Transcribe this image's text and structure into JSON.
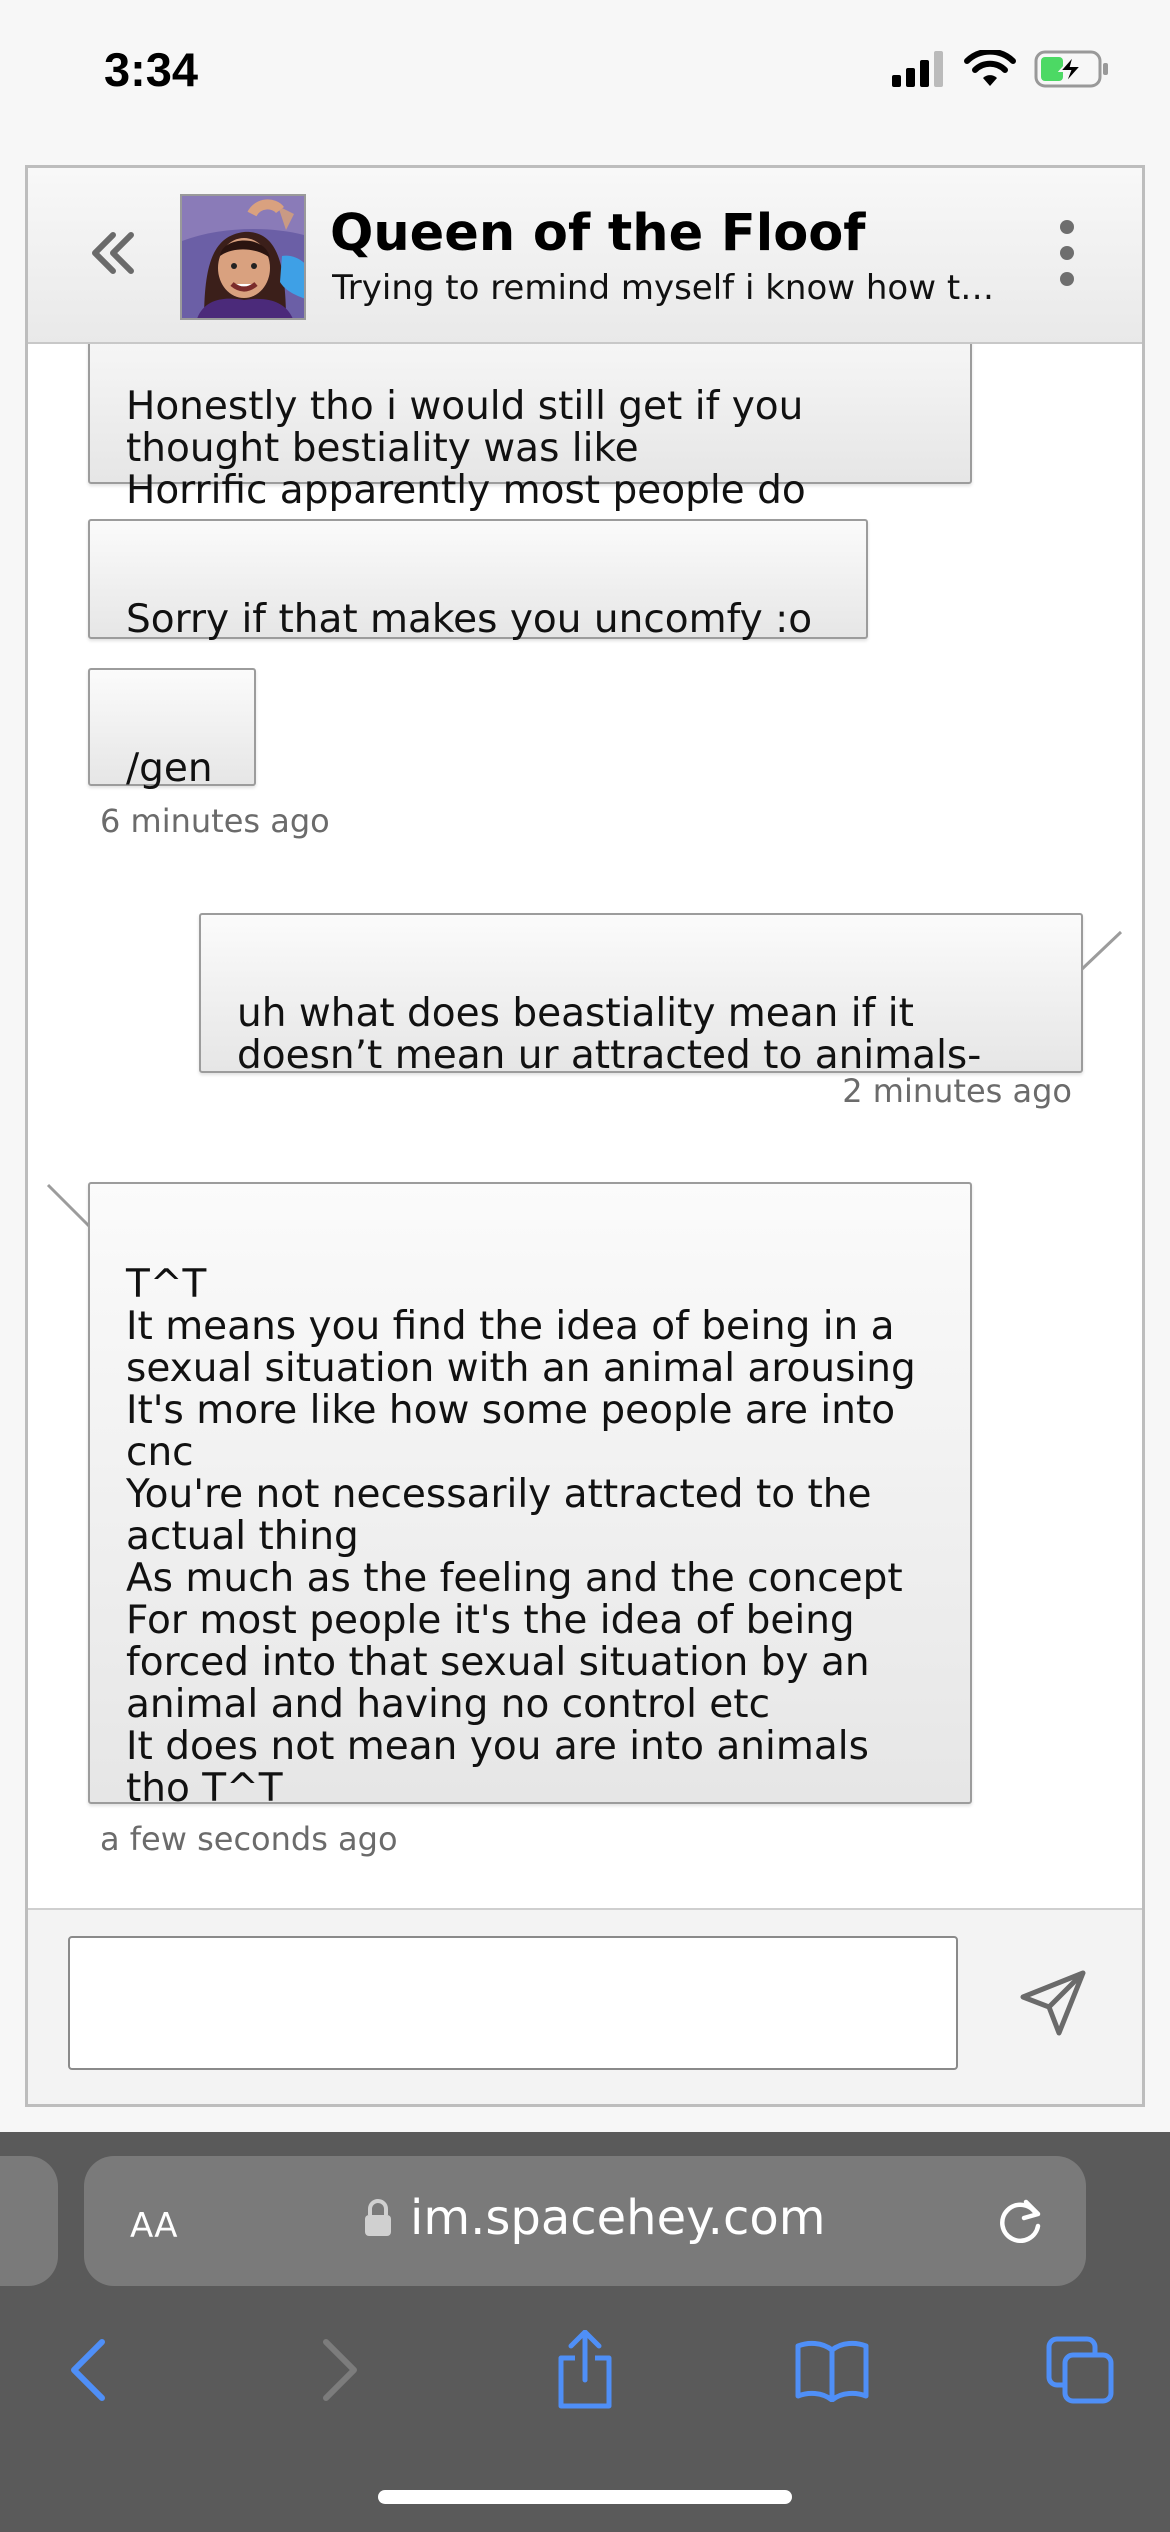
{
  "status_bar": {
    "time": "3:34"
  },
  "chat": {
    "contact_name": "Queen of the Floof",
    "contact_status": "Trying to remind myself i know how to...",
    "messages": [
      {
        "direction": "received",
        "text": "Honestly tho i would still get if you\nthought bestiality was like\nHorrific apparently most people do"
      },
      {
        "direction": "received",
        "text": "Sorry if that makes you uncomfy :o"
      },
      {
        "direction": "received",
        "text": "/gen"
      },
      {
        "direction": "sent",
        "text": "uh what does beastiality mean if it\ndoesn’t mean ur attracted to animals-"
      },
      {
        "direction": "received",
        "text": "T^T\nIt means you find the idea of being in a\nsexual situation with an animal arousing\nIt's more like how some people are into\ncnc\nYou're not necessarily attracted to the\nactual thing\nAs much as the feeling and the concept\nFor most people it's the idea of being\nforced into that sexual situation by an\nanimal and having no control etc\nIt does not mean you are into animals\ntho T^T"
      }
    ],
    "timestamps": [
      "6 minutes ago",
      "2 minutes ago",
      "a few seconds ago"
    ],
    "composer": {
      "value": ""
    }
  },
  "browser": {
    "text_size_button_label": "AA",
    "url": "im.spacehey.com"
  },
  "icons": {
    "back": "double-chevron-left-icon",
    "menu": "vertical-ellipsis-icon",
    "send": "paper-plane-icon",
    "lock": "lock-icon",
    "reload": "reload-icon",
    "nav_back": "chevron-left-icon",
    "nav_forward": "chevron-right-icon",
    "share": "share-icon",
    "bookmarks": "book-icon",
    "tabs": "tabs-icon"
  },
  "colors": {
    "browser_accent": "#4f8ff7",
    "battery_fill": "#4cd964",
    "safari_background": "#5a5a5a"
  }
}
